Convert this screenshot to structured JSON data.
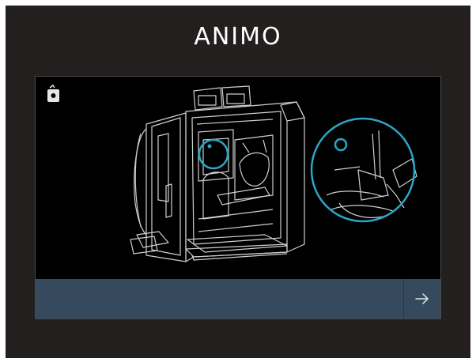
{
  "header": {
    "brand": "ANIMO"
  },
  "panel": {
    "machine_icon": "coffee-machine-icon",
    "instruction_text": "",
    "next_icon": "arrow-right-icon"
  },
  "colors": {
    "screen_background": "#231f1f",
    "panel_background": "#000000",
    "bar_background": "#364a5d",
    "highlight": "#2aa6c8",
    "line_art": "#cfcfcf"
  }
}
